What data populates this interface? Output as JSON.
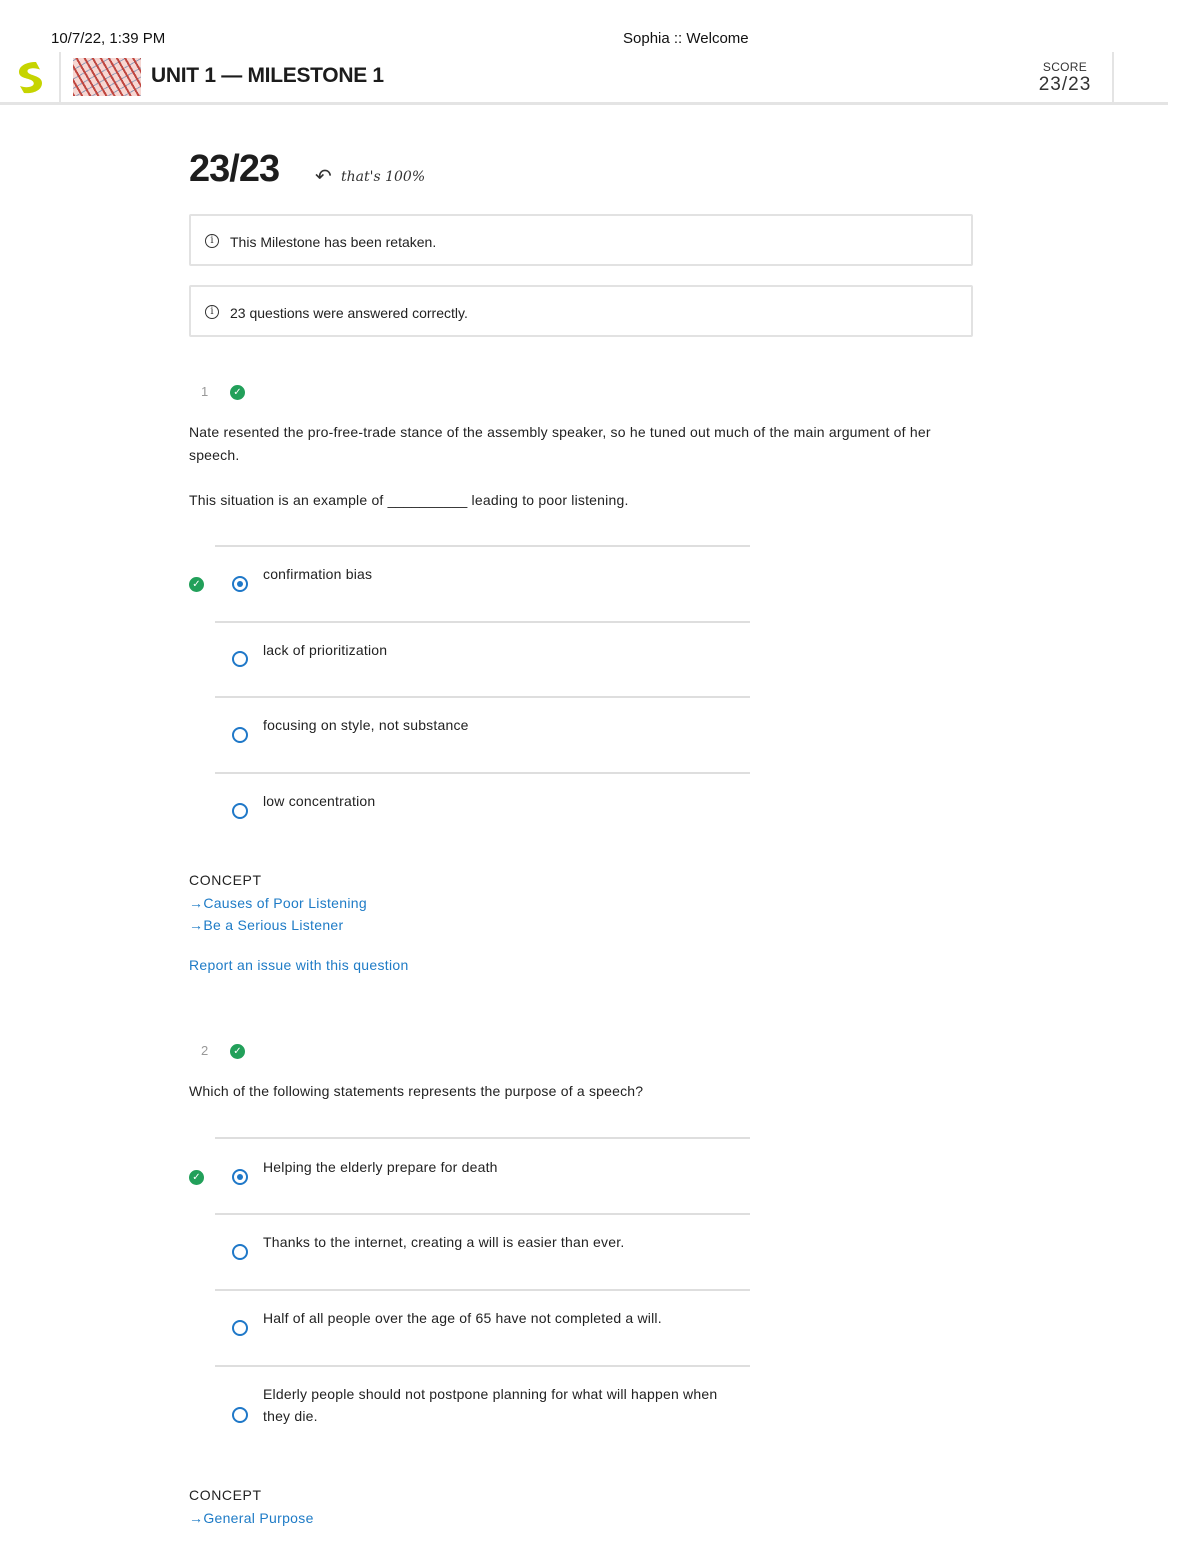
{
  "print_header": {
    "datetime": "10/7/22, 1:39 PM",
    "page_title": "Sophia :: Welcome"
  },
  "app_header": {
    "title": "UNIT 1 — MILESTONE 1",
    "score_label": "SCORE",
    "score_value": "23/23"
  },
  "summary": {
    "score": "23/23",
    "note": "that's 100%",
    "notices": [
      "This Milestone has been retaken.",
      "23 questions were answered correctly."
    ]
  },
  "questions": [
    {
      "number": "1",
      "status": "correct",
      "text_lines": [
        "Nate resented the pro-free-trade stance of the assembly speaker, so he tuned out much of the main argument of her speech.",
        "This situation is an example of __________ leading to poor listening."
      ],
      "options": [
        {
          "label": "confirmation bias",
          "selected": true,
          "correct": true
        },
        {
          "label": "lack of prioritization",
          "selected": false,
          "correct": false
        },
        {
          "label": "focusing on style, not substance",
          "selected": false,
          "correct": false
        },
        {
          "label": "low concentration",
          "selected": false,
          "correct": false
        }
      ],
      "concept_heading": "CONCEPT",
      "concepts": [
        "Causes of Poor Listening",
        "Be a Serious Listener"
      ],
      "report_link": "Report an issue with this question"
    },
    {
      "number": "2",
      "status": "correct",
      "text_lines": [
        "Which of the following statements represents the purpose of a speech?"
      ],
      "options": [
        {
          "label": "Helping the elderly prepare for death",
          "selected": true,
          "correct": true
        },
        {
          "label": "Thanks to the internet, creating a will is easier than ever.",
          "selected": false,
          "correct": false
        },
        {
          "label": "Half of all people over the age of 65 have not completed a will.",
          "selected": false,
          "correct": false
        },
        {
          "label": "Elderly people should not postpone planning for what will happen when they die.",
          "selected": false,
          "correct": false
        }
      ],
      "concept_heading": "CONCEPT",
      "concepts": [
        "General Purpose"
      ]
    }
  ],
  "icons": {
    "arrow": "→",
    "back_arrow": "↶",
    "check": "✓",
    "info": "i"
  },
  "colors": {
    "accent": "#1e7bc6",
    "correct": "#22a05a",
    "logo": "#c6d400"
  }
}
